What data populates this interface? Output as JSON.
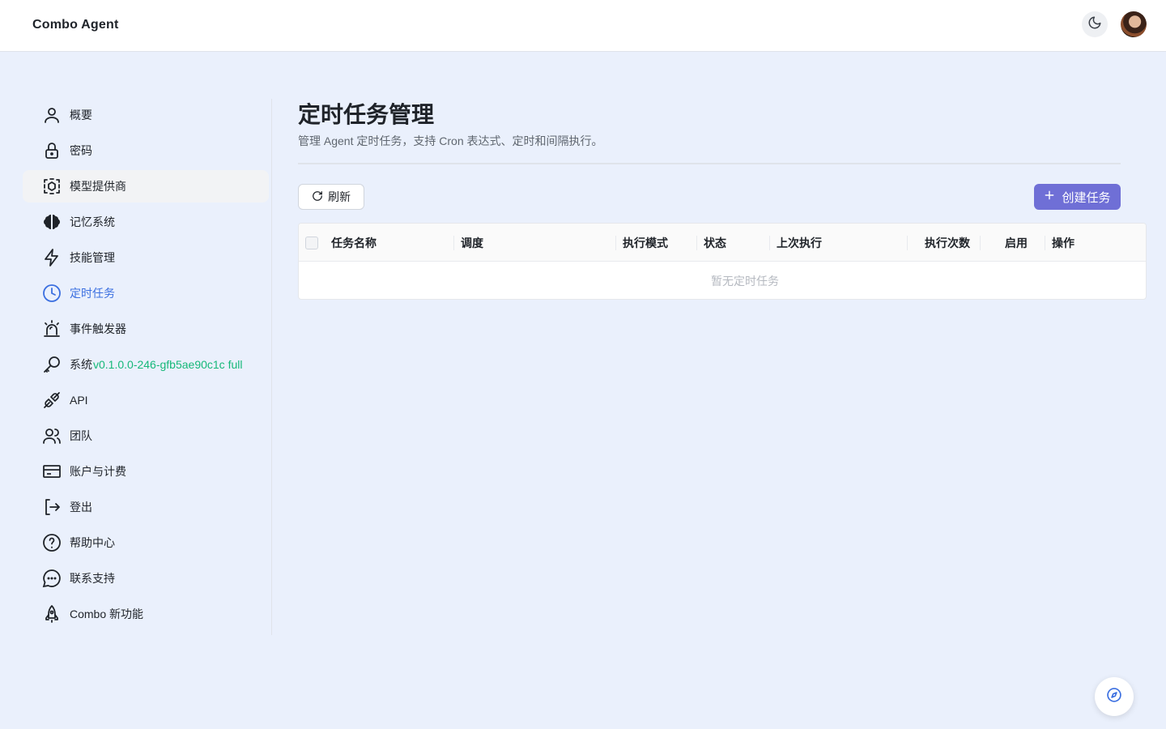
{
  "header": {
    "app_title": "Combo Agent",
    "theme_icon": "moon-icon",
    "avatar_icon": "user-avatar"
  },
  "sidebar": {
    "items": [
      {
        "label": "概要",
        "icon": "user-icon"
      },
      {
        "label": "密码",
        "icon": "lock-icon"
      },
      {
        "label": "模型提供商",
        "icon": "cube-scan-icon"
      },
      {
        "label": "记忆系统",
        "icon": "brain-icon"
      },
      {
        "label": "技能管理",
        "icon": "bolt-icon"
      },
      {
        "label": "定时任务",
        "icon": "clock-icon"
      },
      {
        "label": "事件触发器",
        "icon": "alarm-siren-icon"
      },
      {
        "label": "系统",
        "version": "v0.1.0.0-246-gfb5ae90c1c full",
        "icon": "key-icon"
      },
      {
        "label": "API",
        "icon": "plug-icon"
      },
      {
        "label": "团队",
        "icon": "users-icon"
      },
      {
        "label": "账户与计费",
        "icon": "credit-card-icon"
      },
      {
        "label": "登出",
        "icon": "logout-icon"
      },
      {
        "label": "帮助中心",
        "icon": "help-circle-icon"
      },
      {
        "label": "联系支持",
        "icon": "chat-bubble-icon"
      },
      {
        "label": "Combo 新功能",
        "icon": "rocket-icon"
      }
    ],
    "active_index": 5,
    "hovered_index": 2,
    "active_color": "#3b6fe0",
    "version_color": "#16b879"
  },
  "main": {
    "title": "定时任务管理",
    "description": "管理 Agent 定时任务，支持 Cron 表达式、定时和间隔执行。",
    "toolbar": {
      "refresh_label": "刷新",
      "create_label": "创建任务",
      "create_color": "#6f6fd6"
    },
    "table": {
      "columns": [
        "任务名称",
        "调度",
        "执行模式",
        "状态",
        "上次执行",
        "执行次数",
        "启用",
        "操作"
      ],
      "rows": [],
      "empty_text": "暂无定时任务"
    }
  },
  "fab": {
    "icon": "compass-icon"
  }
}
